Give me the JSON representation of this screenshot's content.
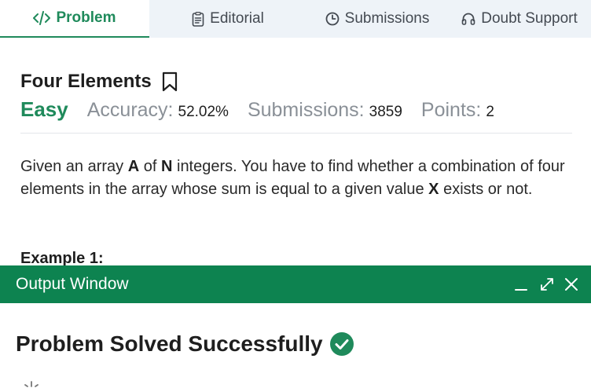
{
  "tabs": [
    {
      "label": "Problem",
      "icon": "code-icon",
      "active": true
    },
    {
      "label": "Editorial",
      "icon": "document-icon",
      "active": false
    },
    {
      "label": "Submissions",
      "icon": "clock-icon",
      "active": false
    },
    {
      "label": "Doubt Support",
      "icon": "headphones-icon",
      "active": false
    }
  ],
  "problem": {
    "title": "Four Elements",
    "difficulty": "Easy",
    "accuracy_label": "Accuracy:",
    "accuracy_value": "52.02%",
    "submissions_label": "Submissions:",
    "submissions_value": "3859",
    "points_label": "Points:",
    "points_value": "2",
    "description": {
      "t1": "Given an array ",
      "a": "A",
      "t2": " of ",
      "n": "N",
      "t3": " integers. You have to find whether a combination of four elements in the array whose sum is equal to a given value ",
      "x": "X",
      "t4": " exists or not."
    },
    "example_heading": "Example 1:"
  },
  "output_window": {
    "title": "Output Window",
    "result": "Problem Solved Successfully"
  },
  "colors": {
    "accent_green": "#1f8a5b",
    "header_green": "#0d8350",
    "tab_bar_bg": "#eef3f8",
    "muted_text": "#8a9097"
  }
}
